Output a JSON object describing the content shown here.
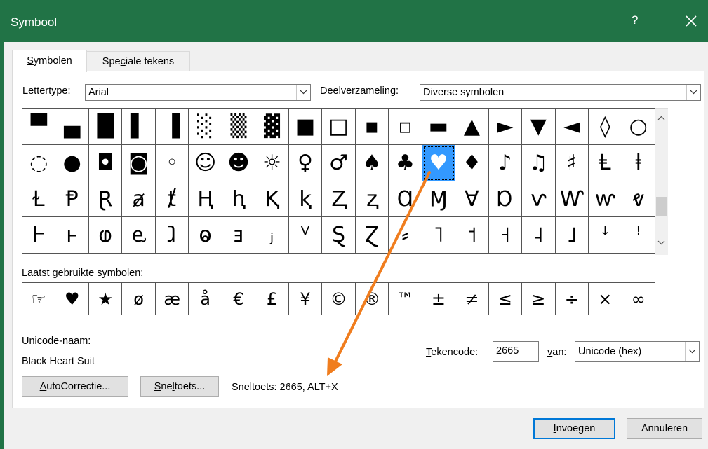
{
  "window": {
    "title": "Symbool",
    "help": "?"
  },
  "tabs": [
    {
      "label_u": "S",
      "label_rest": "ymbolen"
    },
    {
      "label_pre": "Spe",
      "label_u": "c",
      "label_rest": "iale tekens"
    }
  ],
  "font": {
    "label_u": "L",
    "label_rest": "ettertype:",
    "value": "Arial"
  },
  "subset": {
    "label_u": "D",
    "label_rest": "eelverzameling:",
    "value": "Diverse symbolen"
  },
  "symbol_grid": [
    [
      "▀",
      "▄",
      "█",
      "▌",
      "▐",
      "░",
      "▒",
      "▓",
      "■",
      "□",
      "▪",
      "▫",
      "▬",
      "▲",
      "►",
      "▼",
      "◄",
      "◊",
      "○"
    ],
    [
      "◌",
      "●",
      "◘",
      "◙",
      "◦",
      "☺",
      "☻",
      "☼",
      "♀",
      "♂",
      "♠",
      "♣",
      "♥",
      "♦",
      "♪",
      "♫",
      "♯",
      "Ⱡ",
      "ⱡ"
    ],
    [
      "Ɫ",
      "Ᵽ",
      "Ɽ",
      "ⱥ",
      "ⱦ",
      "Ⱨ",
      "ⱨ",
      "Ⱪ",
      "ⱪ",
      "Ⱬ",
      "ⱬ",
      "Ɑ",
      "Ɱ",
      "Ɐ",
      "Ɒ",
      "ⱱ",
      "Ⱳ",
      "ⱳ",
      "ⱴ"
    ],
    [
      "Ⱶ",
      "ⱶ",
      "ⱷ",
      "ⱸ",
      "ⱹ",
      "ⱺ",
      "ⱻ",
      "ⱼ",
      "ⱽ",
      "Ȿ",
      "Ɀ",
      "⸗",
      "˥",
      "˦",
      "˧",
      "˨",
      "˩",
      "ꜜ",
      "ꜝ"
    ]
  ],
  "recent": {
    "label_pre": "Laatst gebruikte sy",
    "label_u": "m",
    "label_rest": "bolen:",
    "symbols": [
      "☞",
      "♥",
      "★",
      "ø",
      "æ",
      "å",
      "€",
      "£",
      "¥",
      "©",
      "®",
      "™",
      "±",
      "≠",
      "≤",
      "≥",
      "÷",
      "×",
      "∞"
    ]
  },
  "unicode_name": {
    "label": "Unicode-naam:",
    "value": "Black Heart Suit"
  },
  "charcode": {
    "label_u": "T",
    "label_rest": "ekencode:",
    "value": "2665"
  },
  "from": {
    "label_u": "v",
    "label_rest": "an:",
    "value": "Unicode (hex)"
  },
  "autocorrect": {
    "label_u": "A",
    "label_rest": "utoCorrectie..."
  },
  "shortcut_key": {
    "label_u": "S",
    "label_pre2": "ne",
    "label_u2": "l",
    "label_rest": "toets..."
  },
  "shortcut_text": "Sneltoets: 2665, ALT+X",
  "insert": {
    "label_u": "I",
    "label_rest": "nvoegen"
  },
  "cancel": {
    "label": "Annuleren"
  },
  "colors": {
    "titlebar": "#217346",
    "selection": "#3399ff",
    "arrow": "#f07d1e",
    "default_button_border": "#0078d7"
  }
}
